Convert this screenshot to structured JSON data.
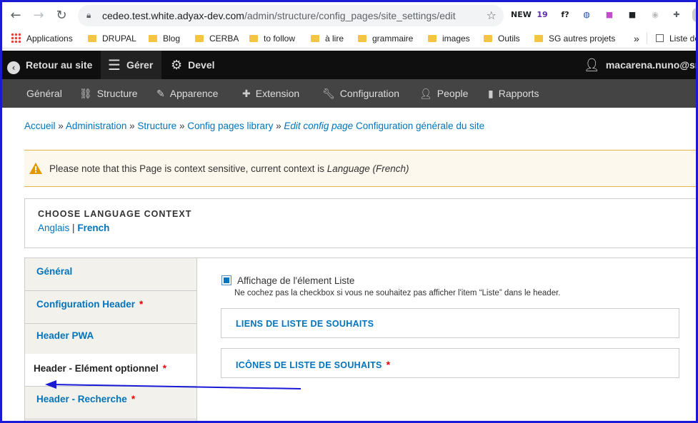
{
  "browser": {
    "url_host": "cedeo.test.white.adyax-dev.com",
    "url_path": "/admin/structure/config_pages/site_settings/edit",
    "extensions": [
      {
        "name": "new-extension-icon",
        "text": "NEW",
        "color": "#202124"
      },
      {
        "name": "calendar-extension-icon",
        "text": "19",
        "color": "#5b2ea6"
      },
      {
        "name": "function-extension-icon",
        "text": "f?",
        "color": "#202124"
      },
      {
        "name": "circle-extension-icon",
        "text": "◍",
        "color": "#1a4ea8"
      },
      {
        "name": "gradient-extension-icon",
        "text": "■",
        "color": "#c04ec8"
      },
      {
        "name": "game-extension-icon",
        "text": "■",
        "color": "#202124"
      },
      {
        "name": "eye-extension-icon",
        "text": "◉",
        "color": "#bbbbbb"
      },
      {
        "name": "puzzle-extension-icon",
        "text": "✚",
        "color": "#5f6368"
      }
    ]
  },
  "bookmarks": {
    "apps": "Applications",
    "items": [
      "DRUPAL",
      "Blog",
      "CERBA",
      "to follow",
      "à lire",
      "grammaire",
      "images",
      "Outils",
      "SG autres projets"
    ],
    "overflow": "»",
    "reading_list": "Liste de"
  },
  "toolbar": {
    "back": "Retour au site",
    "manage": "Gérer",
    "devel": "Devel",
    "user": "macarena.nuno@smi"
  },
  "tray": {
    "items": [
      "Général",
      "Structure",
      "Apparence",
      "Extension",
      "Configuration",
      "People",
      "Rapports"
    ]
  },
  "breadcrumb": {
    "home": "Accueil",
    "admin": "Administration",
    "structure": "Structure",
    "library": "Config pages library",
    "edit_prefix": "Edit config page",
    "current": "Configuration générale du site",
    "sep": "»"
  },
  "warning": {
    "text": "Please note that this Page is context sensitive, current context is",
    "context": "Language (French)"
  },
  "language": {
    "title": "CHOOSE LANGUAGE CONTEXT",
    "option_en": "Anglais",
    "separator": "|",
    "option_fr": "French"
  },
  "vertical_tabs": [
    {
      "label": "Général",
      "required": false
    },
    {
      "label": "Configuration Header",
      "required": true
    },
    {
      "label": "Header PWA",
      "required": false
    },
    {
      "label": "Header - Elément optionnel",
      "required": true
    },
    {
      "label": "Header - Recherche",
      "required": true
    }
  ],
  "required_mark": "*",
  "pane": {
    "checkbox_label": "Affichage de l'élement Liste",
    "checkbox_checked": true,
    "checkbox_desc": "Ne cochez pas la checkbox si vous ne souhaitez pas afficher l'item “Liste” dans le header.",
    "details_1": "LIENS DE LISTE DE SOUHAITS",
    "details_2": "ICÔNES DE LISTE DE SOUHAITS"
  },
  "colors": {
    "link": "#0074bd",
    "annotation_arrow": "#1a1ad6",
    "warning_border": "#e0b64a"
  }
}
